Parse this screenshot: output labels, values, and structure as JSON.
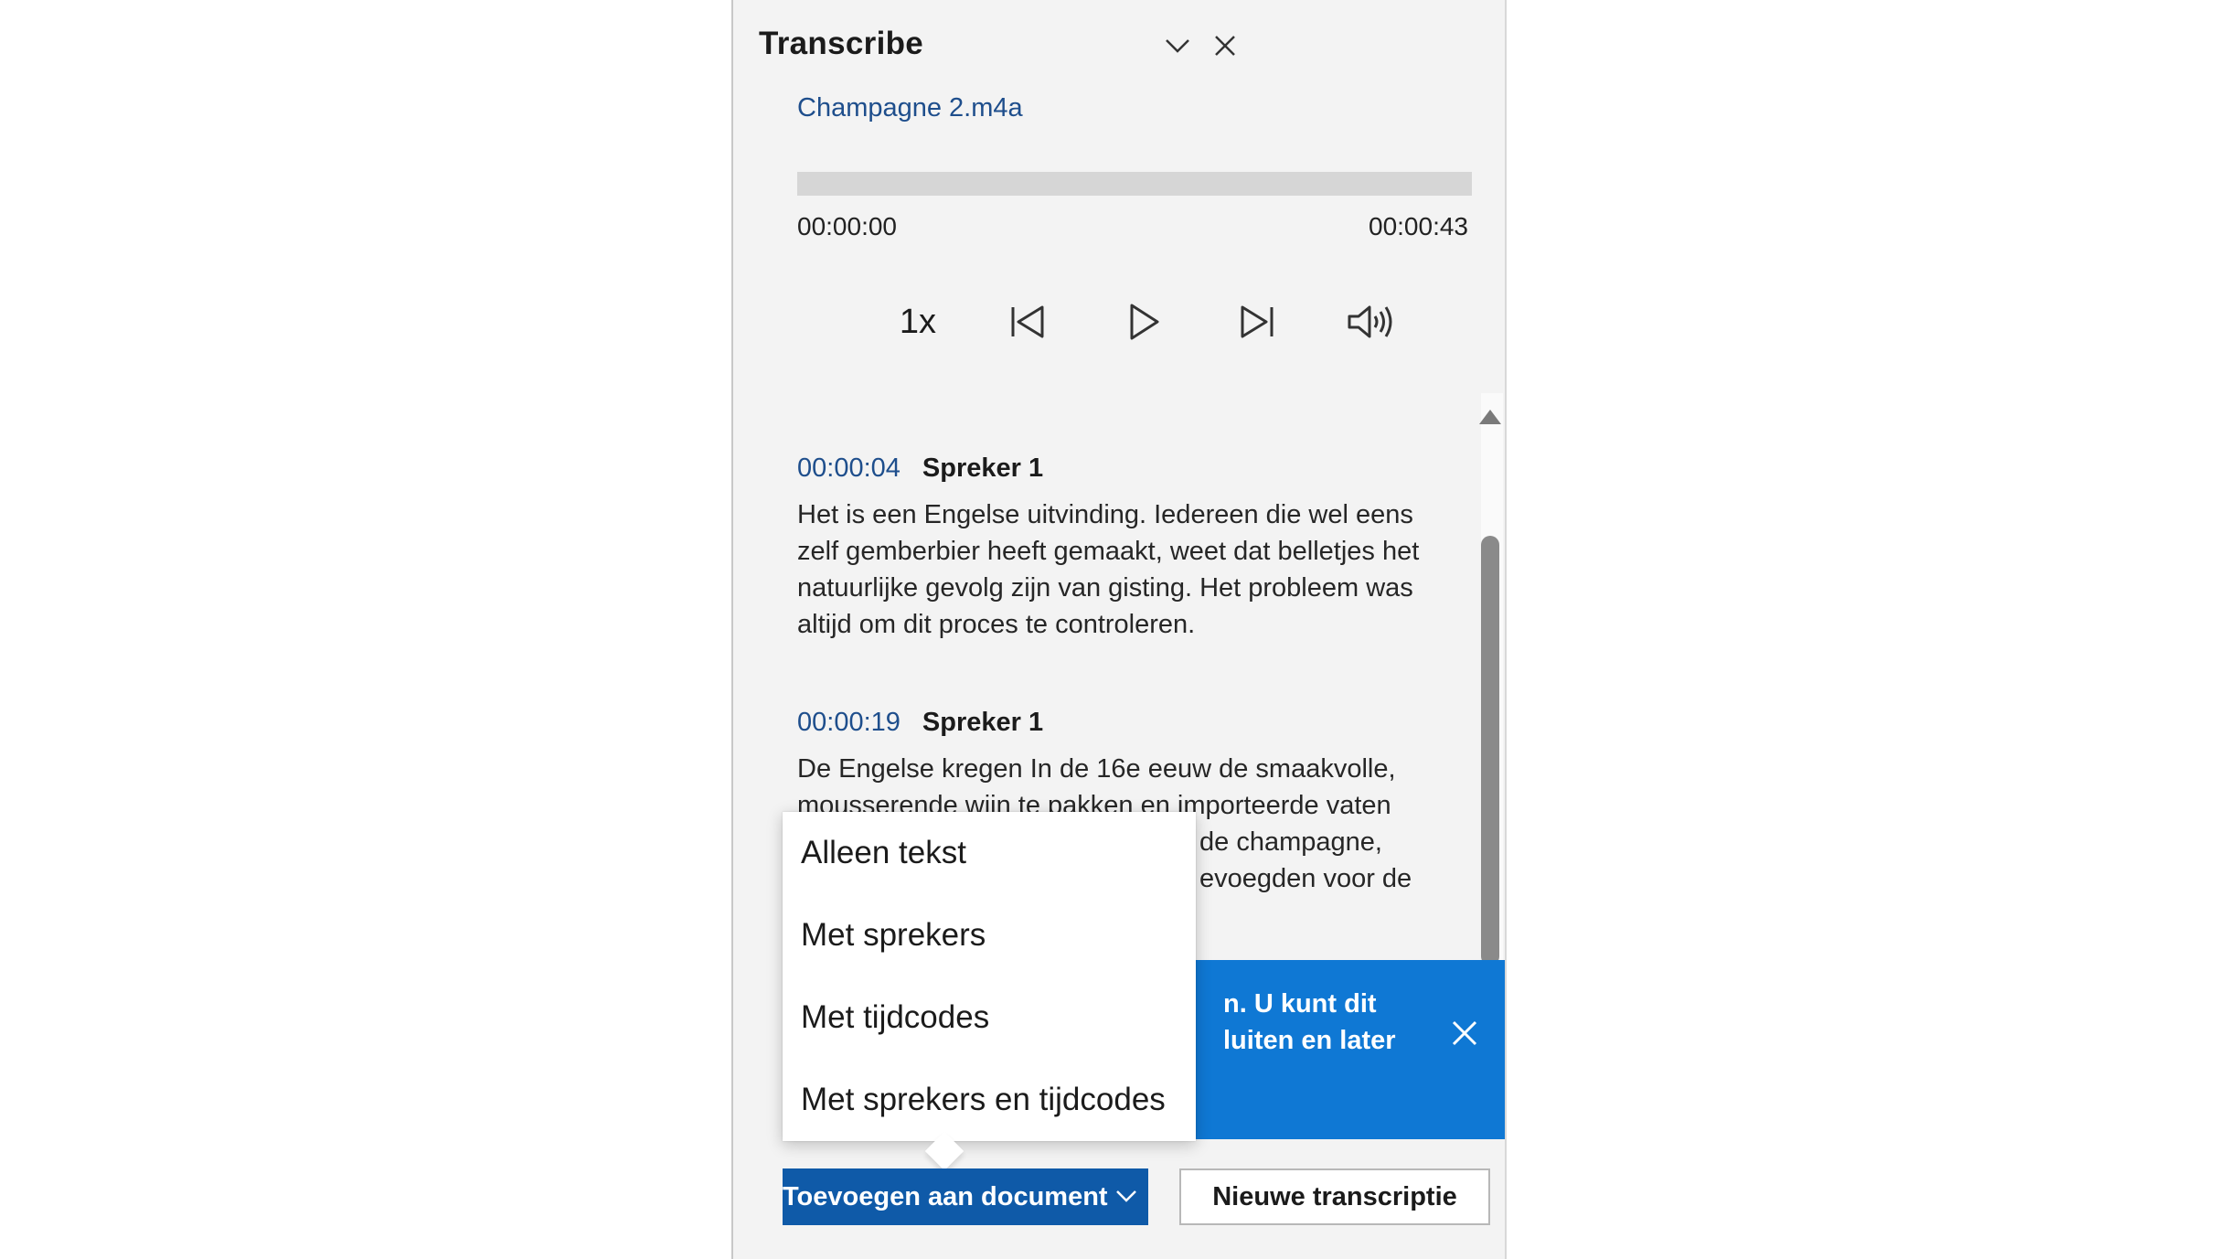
{
  "pane": {
    "title": "Transcribe",
    "collapse_icon": "chevron-down-icon",
    "close_icon": "close-icon"
  },
  "player": {
    "file_name": "Champagne 2.m4a",
    "current_time": "00:00:00",
    "total_time": "00:00:43",
    "progress": 0,
    "speed": "1x",
    "icons": [
      "rewind-icon",
      "play-icon",
      "forward-icon",
      "volume-icon"
    ]
  },
  "transcript": [
    {
      "timestamp": "00:00:04",
      "speaker": "Spreker 1",
      "lines": [
        "Het is een Engelse uitvinding. Iedereen die wel eens",
        "zelf gemberbier heeft gemaakt, weet dat belletjes het",
        "natuurlijke gevolg zijn van gisting. Het probleem was",
        "altijd om dit proces te controleren."
      ]
    },
    {
      "timestamp": "00:00:19",
      "speaker": "Spreker 1",
      "lines": [
        "De Engelse kregen In de 16e eeuw de smaakvolle,",
        "mousserende wijn te pakken en importeerde vaten",
        "de champagne,",
        "evoegden voor de"
      ]
    }
  ],
  "toast": {
    "text": "n. U kunt dit\nluiten en later",
    "close_icon": "close-icon"
  },
  "menu": {
    "items": [
      "Alleen tekst",
      "Met sprekers",
      "Met tijdcodes",
      "Met sprekers en tijdcodes"
    ]
  },
  "footer": {
    "add_label": "Toevoegen aan document",
    "new_label": "Nieuwe transcriptie"
  },
  "colors": {
    "accent": "#1e4e8c",
    "primary_button": "#0f5aa8",
    "toast": "#0f78d4",
    "pane_bg": "#f3f3f3"
  }
}
